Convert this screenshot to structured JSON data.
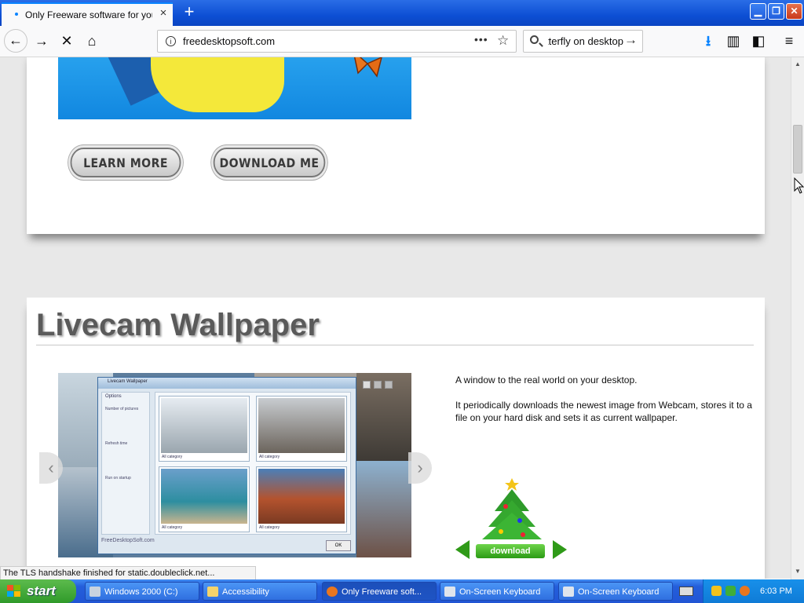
{
  "browser": {
    "tab_title": "Only Freeware software for your Windows",
    "tab_close": "×",
    "new_tab": "+",
    "url": "freedesktopsoft.com",
    "page_actions": "•••",
    "search_value": "butterfly on desktop",
    "icons": [
      "back-arrow-icon",
      "forward-arrow-icon",
      "stop-icon",
      "home-icon",
      "info-icon",
      "bookmark-star-icon",
      "search-icon",
      "download-icon",
      "library-icon",
      "sidebar-icon",
      "hamburger-menu-icon"
    ]
  },
  "page": {
    "promo": {
      "learn_more": "LEARN MORE",
      "download_me": "DOWNLOAD ME"
    },
    "section": {
      "title": "Livecam Wallpaper",
      "desc": [
        "A window to the real world on your desktop.",
        "It periodically downloads the newest image from Webcam, stores it to a file on your hard disk and sets it as current wallpaper."
      ],
      "download_label": "download"
    },
    "screenshot": {
      "app_title": "Livecam Wallpaper",
      "options": "Options",
      "labels": [
        "Number of pictures",
        "Refresh time",
        "Run on startup"
      ],
      "footer": "FreeDesktopSoft.com",
      "ok": "OK",
      "captions": [
        "All category",
        "All category",
        "All category",
        "All category"
      ]
    }
  },
  "status": "The TLS handshake finished for static.doubleclick.net...",
  "taskbar": {
    "start": "start",
    "tasks": [
      "Windows 2000 (C:)",
      "Accessibility",
      "Only Freeware soft...",
      "On-Screen Keyboard",
      "On-Screen Keyboard"
    ],
    "clock": "6:03 PM"
  },
  "colors": {
    "tab_accent": "#0a84ff",
    "taskbar_blue": "#245edb",
    "start_green": "#2f9a2a",
    "title_gray": "#5a5a5a",
    "download_green": "#2b9b14"
  }
}
